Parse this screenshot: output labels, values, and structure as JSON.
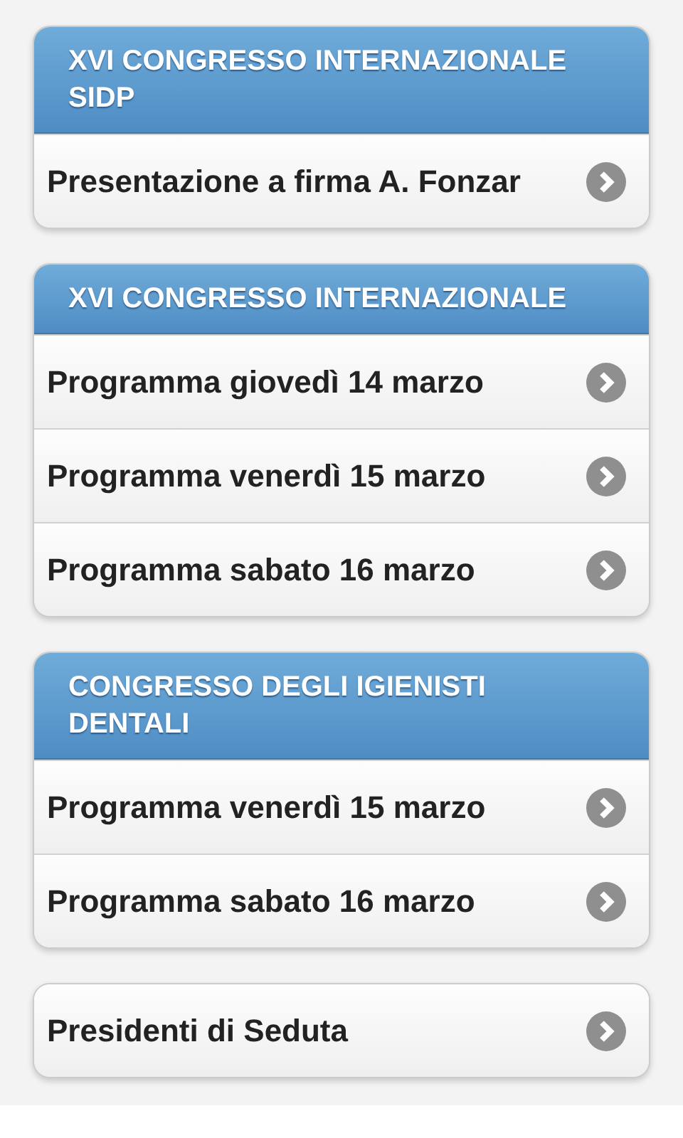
{
  "sections": [
    {
      "header": "XVI CONGRESSO INTERNAZIONALE SIDP",
      "items": [
        {
          "label": "Presentazione a firma A. Fonzar"
        }
      ]
    },
    {
      "header": "XVI CONGRESSO INTERNAZIONALE",
      "items": [
        {
          "label": "Programma giovedì 14 marzo"
        },
        {
          "label": "Programma venerdì 15 marzo"
        },
        {
          "label": "Programma sabato 16 marzo"
        }
      ]
    },
    {
      "header": "CONGRESSO DEGLI IGIENISTI DENTALI",
      "items": [
        {
          "label": "Programma venerdì 15 marzo"
        },
        {
          "label": "Programma sabato 16 marzo"
        }
      ]
    },
    {
      "items": [
        {
          "label": "Presidenti di Seduta"
        }
      ]
    }
  ]
}
